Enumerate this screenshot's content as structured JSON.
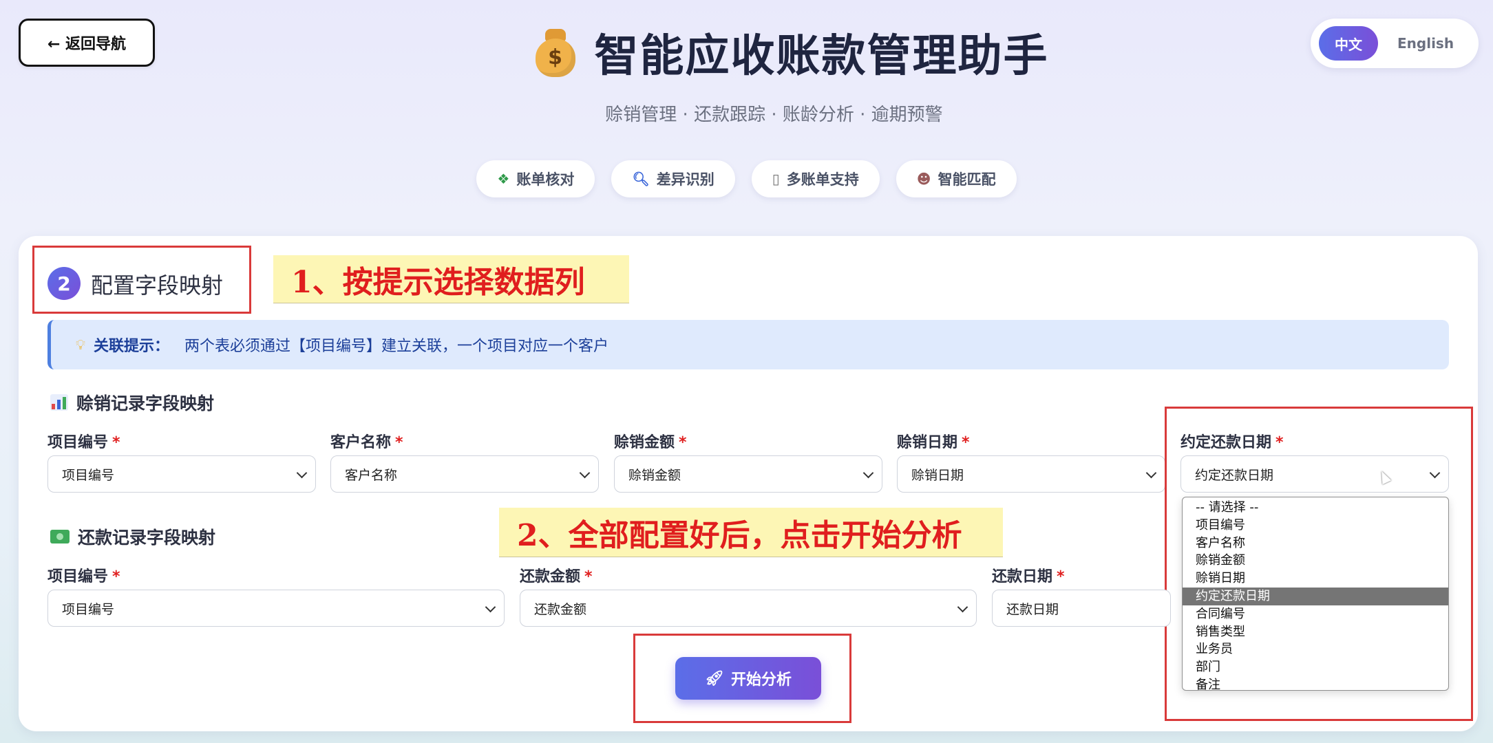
{
  "nav": {
    "back_label": "← 返回导航"
  },
  "header": {
    "title": "智能应收账款管理助手",
    "subtitle": "赊销管理 · 还款跟踪 · 账龄分析 · 逾期预警",
    "icon": "money-bag-icon",
    "icon_text": "$"
  },
  "lang": {
    "zh": "中文",
    "en": "English"
  },
  "chips": [
    {
      "icon": "money-icon",
      "label": "账单核对"
    },
    {
      "icon": "search-icon",
      "label": "差异识别"
    },
    {
      "icon": "document-icon",
      "label": "多账单支持"
    },
    {
      "icon": "robot-icon",
      "label": "智能匹配"
    }
  ],
  "step": {
    "number": "2",
    "title": "配置字段映射"
  },
  "annotations": {
    "a1": "1、按提示选择数据列",
    "a2": "2、全部配置好后，点击开始分析"
  },
  "tip": {
    "label": "关联提示：",
    "text": "两个表必须通过【项目编号】建立关联，一个项目对应一个客户"
  },
  "credit_section": {
    "title": "赊销记录字段映射",
    "fields": [
      {
        "label": "项目编号",
        "req": "*",
        "value": "项目编号"
      },
      {
        "label": "客户名称",
        "req": "*",
        "value": "客户名称"
      },
      {
        "label": "赊销金额",
        "req": "*",
        "value": "赊销金额"
      },
      {
        "label": "赊销日期",
        "req": "*",
        "value": "赊销日期"
      },
      {
        "label": "约定还款日期",
        "req": "*",
        "value": "约定还款日期"
      }
    ]
  },
  "repay_section": {
    "title": "还款记录字段映射",
    "fields": [
      {
        "label": "项目编号",
        "req": "*",
        "value": "项目编号"
      },
      {
        "label": "还款金额",
        "req": "*",
        "value": "还款金额"
      },
      {
        "label": "还款日期",
        "req": "*",
        "value": "还款日期"
      }
    ]
  },
  "dropdown": {
    "options": [
      "-- 请选择 --",
      "项目编号",
      "客户名称",
      "赊销金额",
      "赊销日期",
      "约定还款日期",
      "合同编号",
      "销售类型",
      "业务员",
      "部门",
      "备注"
    ],
    "selected": "约定还款日期"
  },
  "start_button": {
    "label": "开始分析",
    "icon": "rocket-icon"
  },
  "colors": {
    "accent": "#5b6ee8",
    "accent2": "#7a4fd8",
    "annotation_red": "#e01e1e",
    "box_red": "#d93a3a"
  }
}
